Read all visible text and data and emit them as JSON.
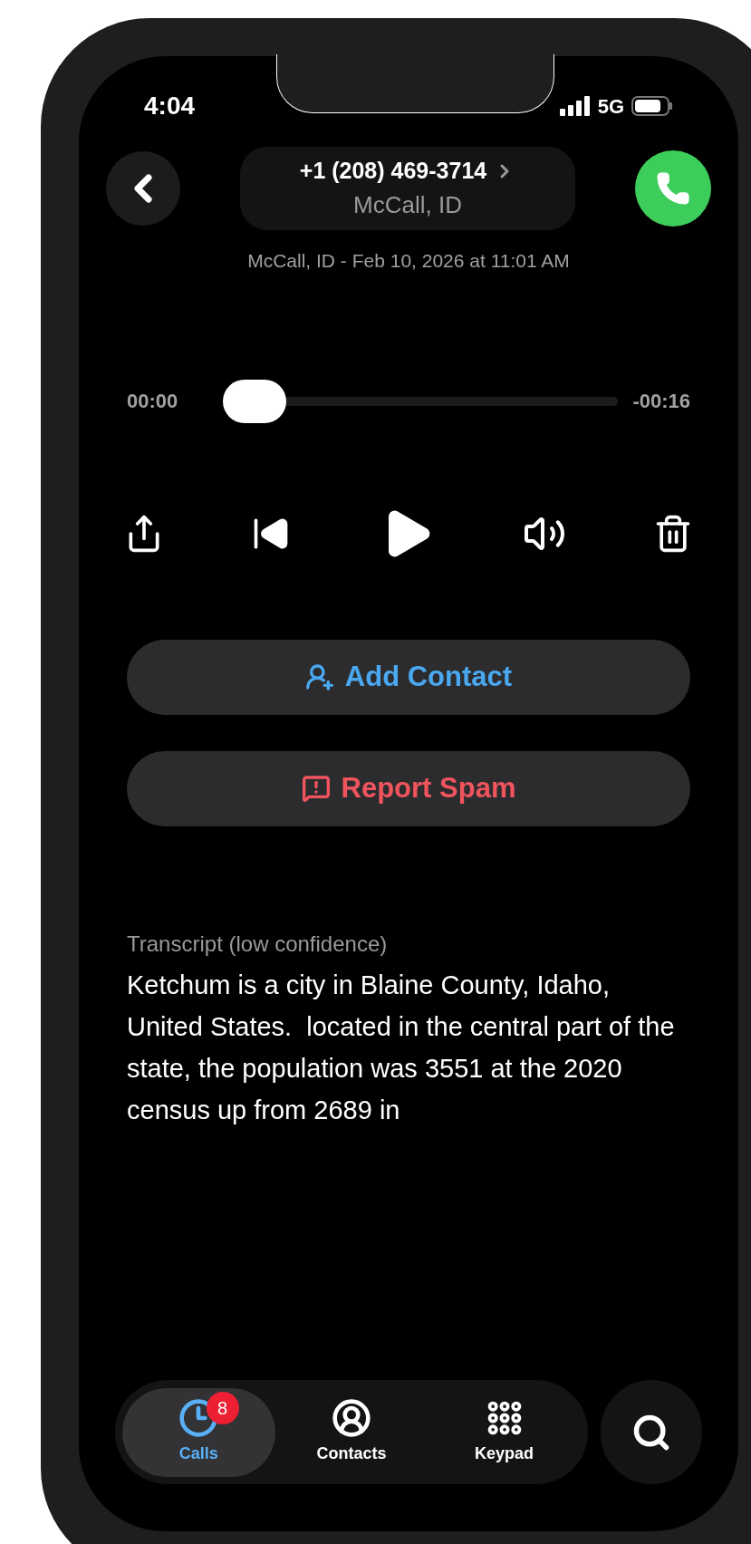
{
  "status_bar": {
    "time": "4:04",
    "network": "5G"
  },
  "header": {
    "phone_number": "+1 (208) 469-3714",
    "location": "McCall, ID",
    "details": "McCall, ID - Feb 10, 2026 at 11:01 AM"
  },
  "player": {
    "elapsed": "00:00",
    "remaining": "-00:16",
    "level": 0
  },
  "actions": [
    {
      "label": "Add Contact",
      "kind": "add_contact"
    },
    {
      "label": "Report Spam",
      "kind": "report_spam"
    }
  ],
  "transcript": {
    "label": "Transcript (low confidence)",
    "text": "Ketchum is a city in Blaine County, Idaho, United States.  located in the central part of the state, the population was 3551 at the 2020 census up from 2689 in"
  },
  "tabs": [
    {
      "label": "Calls",
      "selected": true,
      "badge": "8",
      "kind": "calls"
    },
    {
      "label": "Contacts",
      "selected": false,
      "kind": "contacts"
    },
    {
      "label": "Keypad",
      "selected": false,
      "kind": "keypad"
    }
  ]
}
